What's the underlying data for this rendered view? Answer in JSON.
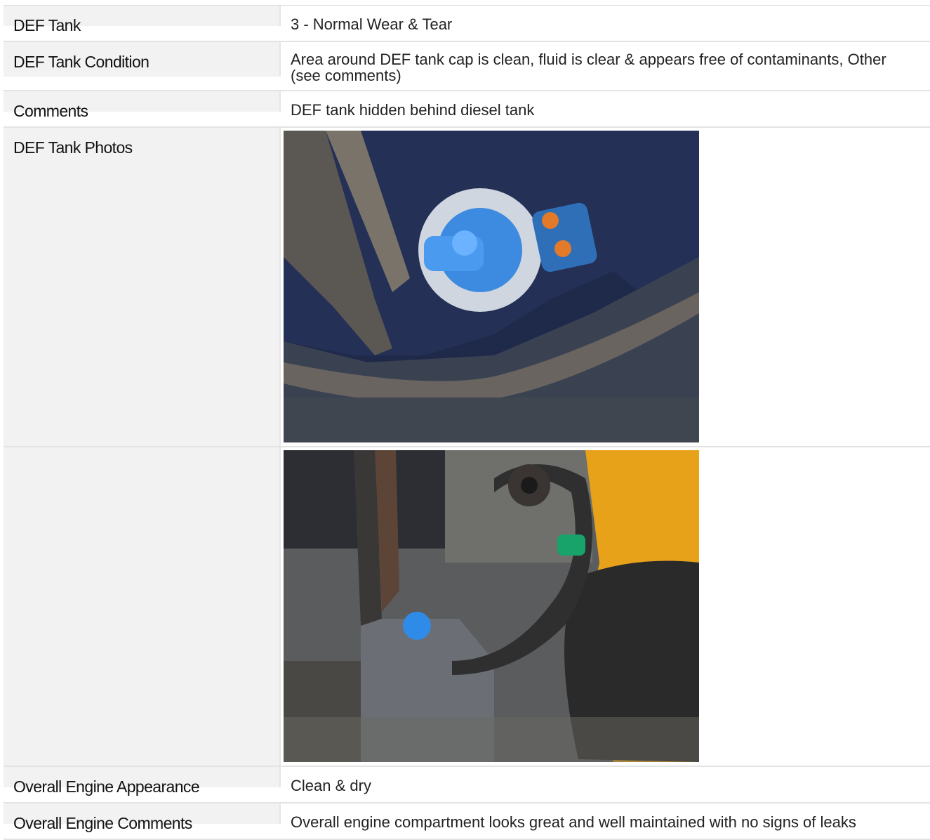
{
  "rows": [
    {
      "label": "DEF Tank",
      "value": "3 - Normal Wear & Tear"
    },
    {
      "label": "DEF Tank Condition",
      "value": "Area around DEF tank cap is clean, fluid is clear & appears free of contaminants, Other (see comments)"
    },
    {
      "label": "Comments",
      "value": "DEF tank hidden behind diesel tank"
    },
    {
      "label": "DEF Tank Photos"
    },
    {
      "label": "Overall Engine Appearance",
      "value": "Clean & dry"
    },
    {
      "label": "Overall Engine Comments",
      "value": "Overall engine compartment looks great and well maintained with no signs of leaks"
    }
  ],
  "photos": [
    {
      "alt": "Close-up of blue DEF tank cap"
    },
    {
      "alt": "DEF tank behind guard next to tire"
    }
  ]
}
